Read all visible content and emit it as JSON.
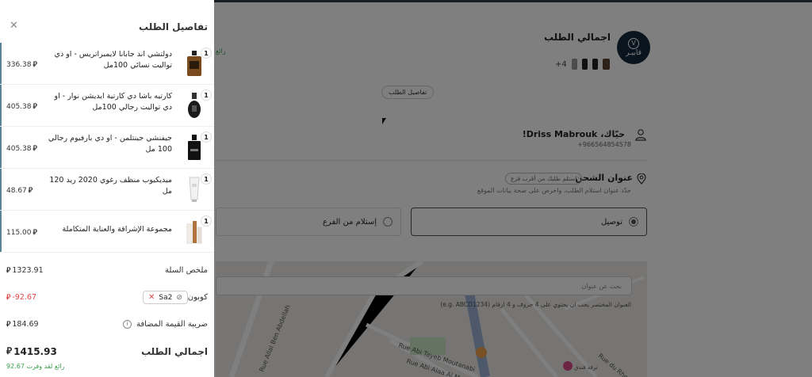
{
  "colors": {
    "accent": "#5b8397",
    "discount": "#e14848",
    "saved": "#3a9e4b",
    "logo_bg": "#14283e"
  },
  "background": {
    "logo_text": "قابيـر",
    "title": "اجمالي الطلب",
    "more_count": "+4",
    "green_note": "رائع",
    "details_button": "تفاصيل الطلب",
    "user_greeting": "حيّاك، Driss Mabrouk!",
    "user_phone": "+966564854578",
    "shipping_title": "عنوان الشحن",
    "shipping_pickup_tag": "استلم طلبك من أقرب فرع",
    "shipping_subtitle": "حدّد عنوان استلام الطلب، واحرص على صحة بيانات الموقع",
    "option_delivery": "توصيل",
    "option_pickup": "إستلام من الفرع",
    "address_search_placeholder": "بحث عن عنوان",
    "address_hint": "العنوان المختصر يجب ان يحتوي على 4 حروف و 4 ارقام (e.g. ABCD1234)",
    "map_labels": [
      "Rue Allal Ben Abdellah",
      "Rue Abi Tayeb Moutanabi",
      "Rue Abi Alaa Al Maarri",
      "Rue du Rhone",
      "ترفة فندق"
    ]
  },
  "drawer": {
    "title": "تفاصيل الطلب",
    "close_icon": "close-icon",
    "currency_symbol": "ر.س",
    "items": [
      {
        "qty": "1",
        "name": "دولتشي اند جابانا لايمبراتريس - او دي تواليت نسائي 100مل",
        "price": "336.38",
        "icon": "amber-perfume-bottle"
      },
      {
        "qty": "1",
        "name": "كارتيه باشا دي كارتية ايديشن نوار - او دي تواليت رجالي 100مل",
        "price": "405.38",
        "icon": "black-perfume-bottle"
      },
      {
        "qty": "1",
        "name": "جيفنشي جينتلمن - او دي بارفيوم رجالي 100 مل",
        "price": "405.38",
        "icon": "black-perfume-bottle"
      },
      {
        "qty": "1",
        "name": "ميديكيوب منظف رغوي 2020 ريد 120 مل",
        "price": "48.67",
        "icon": "white-tube"
      },
      {
        "qty": "1",
        "name": "مجموعة الإشراقة والعناية المتكاملة",
        "price": "115.00",
        "icon": "skincare-set"
      }
    ],
    "summary": {
      "cart_label": "ملخص السلة",
      "cart_value": "1323.91",
      "coupon_label": "كوبون",
      "coupon_code": "Sa2",
      "coupon_value": "-92.67",
      "vat_label": "ضريبة القيمة المضافة",
      "vat_value": "184.69",
      "total_label": "اجمالي الطلب",
      "total_value": "1415.93",
      "saved_text": "رائع لقد وفرت 92.67"
    }
  }
}
